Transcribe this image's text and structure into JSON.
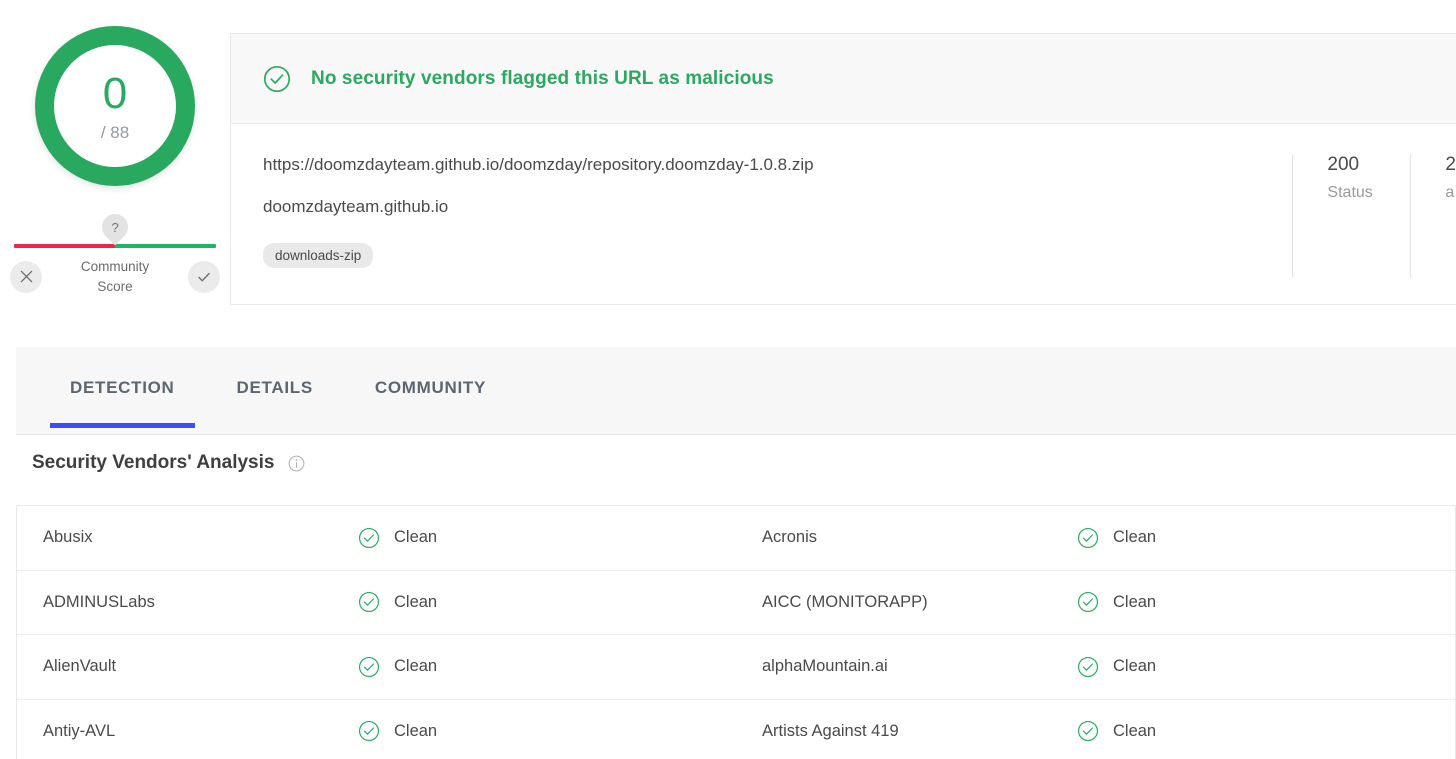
{
  "score": {
    "value": "0",
    "total": "/ 88",
    "color": "#29a85f"
  },
  "community_score": {
    "pin_label": "?",
    "label_line1": "Community",
    "label_line2": "Score",
    "negative_icon": "close-icon",
    "positive_icon": "check-icon",
    "negative_color": "#f0244c",
    "positive_color": "#1fb567"
  },
  "verdict_banner": {
    "icon": "check-circle-icon",
    "text": "No security vendors flagged this URL as malicious",
    "color": "#2aa961"
  },
  "url_info": {
    "url": "https://doomzdayteam.github.io/doomzday/repository.doomzday-1.0.8.zip",
    "host": "doomzdayteam.github.io",
    "tag": "downloads-zip"
  },
  "stats": [
    {
      "value": "200",
      "label": "Status"
    },
    {
      "value": "2",
      "label": "a"
    }
  ],
  "tabs": [
    {
      "label": "DETECTION",
      "active": true
    },
    {
      "label": "DETAILS",
      "active": false
    },
    {
      "label": "COMMUNITY",
      "active": false
    }
  ],
  "vendors_section": {
    "title": "Security Vendors' Analysis",
    "info_icon": "info-icon"
  },
  "vendor_rows": [
    {
      "left": {
        "name": "Abusix",
        "verdict": "Clean",
        "icon": "check-circle-icon"
      },
      "right": {
        "name": "Acronis",
        "verdict": "Clean",
        "icon": "check-circle-icon"
      }
    },
    {
      "left": {
        "name": "ADMINUSLabs",
        "verdict": "Clean",
        "icon": "check-circle-icon"
      },
      "right": {
        "name": "AICC (MONITORAPP)",
        "verdict": "Clean",
        "icon": "check-circle-icon"
      }
    },
    {
      "left": {
        "name": "AlienVault",
        "verdict": "Clean",
        "icon": "check-circle-icon"
      },
      "right": {
        "name": "alphaMountain.ai",
        "verdict": "Clean",
        "icon": "check-circle-icon"
      }
    },
    {
      "left": {
        "name": "Antiy-AVL",
        "verdict": "Clean",
        "icon": "check-circle-icon"
      },
      "right": {
        "name": "Artists Against 419",
        "verdict": "Clean",
        "icon": "check-circle-icon"
      }
    }
  ]
}
